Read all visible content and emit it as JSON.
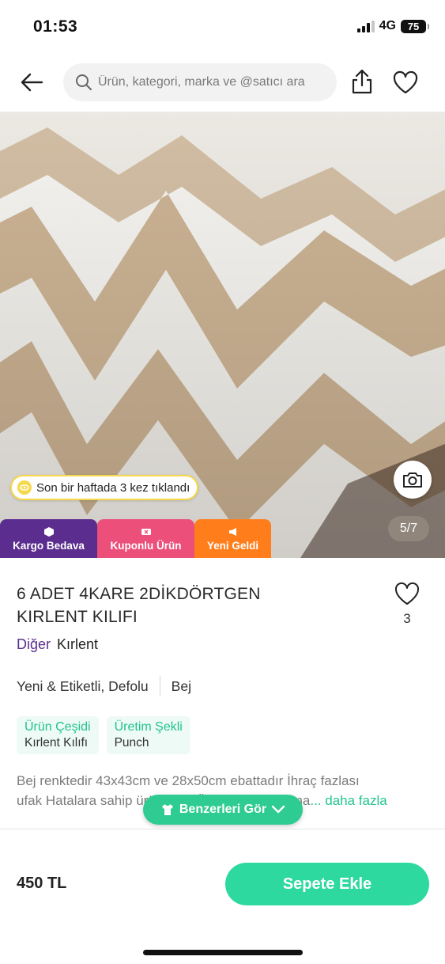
{
  "status": {
    "time": "01:53",
    "network": "4G",
    "battery": "75"
  },
  "header": {
    "search_placeholder": "Ürün, kategori, marka ve @satıcı ara"
  },
  "gallery": {
    "clicked_text": "Son bir haftada 3 kez tıklandı",
    "counter": "5/7",
    "badges": [
      {
        "label": "Kargo Bedava",
        "color": "#5b2d8e"
      },
      {
        "label": "Kuponlu Ürün",
        "color": "#ec4f7a"
      },
      {
        "label": "Yeni Geldi",
        "color": "#ff7e1b"
      }
    ]
  },
  "product": {
    "title": "6 ADET 4KARE 2DİKDÖRTGEN KIRLENT KILIFI",
    "favorite_count": "3",
    "brand": "Diğer",
    "category": "Kırlent",
    "condition": "Yeni & Etiketli, Defolu",
    "color": "Bej",
    "attributes": [
      {
        "key": "Ürün Çeşidi",
        "value": "Kırlent Kılıfı"
      },
      {
        "key": "Üretim Şekli",
        "value": "Punch"
      }
    ],
    "description_line1": "Bej renktedir 43x43cm ve 28x50cm ebattadır İhraç fazlası",
    "description_line2": "ufak Hatalara sahip ürünlerdir Ürünler hatalı olma",
    "more_label": "... daha fazla"
  },
  "similar_button": "Benzerleri Gör",
  "bottom": {
    "price": "450 TL",
    "cart_label": "Sepete Ekle"
  },
  "colors": {
    "accent": "#2ed9a0",
    "brand_purple": "#5b2d8e"
  }
}
